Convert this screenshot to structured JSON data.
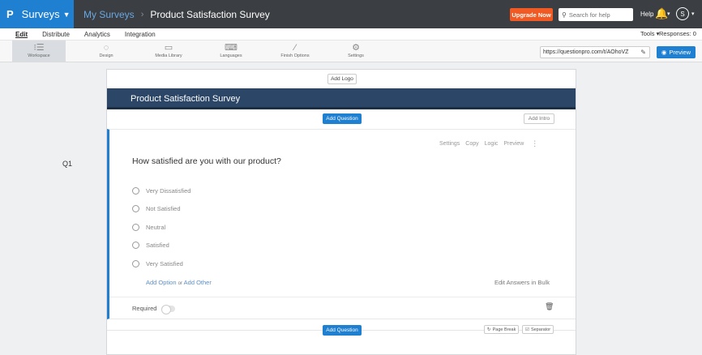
{
  "topbar": {
    "brand_logo": "P",
    "brand_label": "Surveys",
    "breadcrumb_mine": "My Surveys",
    "breadcrumb_sep": "›",
    "survey_title": "Product Satisfaction Survey",
    "upgrade_label": "Upgrade Now",
    "search_placeholder": "Search for help",
    "help_label": "Help",
    "avatar_initial": "S"
  },
  "tabs": {
    "items": [
      "Edit",
      "Distribute",
      "Analytics",
      "Integration"
    ],
    "tools_label": "Tools ▾",
    "responses_label": "Responses: 0"
  },
  "toolbar": {
    "items": [
      "Workspace",
      "Design",
      "Media Library",
      "Languages",
      "Finish Options",
      "Settings"
    ],
    "url_value": "https://questionpro.com/t/AOhoVZ",
    "preview_label": "Preview"
  },
  "survey": {
    "add_logo": "Add Logo",
    "header_title": "Product Satisfaction Survey",
    "add_question": "Add Question",
    "add_intro": "Add Intro",
    "question_number": "Q1",
    "question_actions": [
      "Settings",
      "Copy",
      "Logic",
      "Preview"
    ],
    "question_text": "How satisfied are you with our product?",
    "options": [
      "Very Dissatisfied",
      "Not Satisfied",
      "Neutral",
      "Satisfied",
      "Very Satisfied"
    ],
    "add_option": "Add Option",
    "or_text": "or",
    "add_other": "Add Other",
    "edit_bulk": "Edit Answers in Bulk",
    "required_label": "Required",
    "page_break": "Page Break",
    "separator": "Separator"
  },
  "colors": {
    "brand_blue": "#1f7fd0",
    "upgrade_orange": "#f15a22",
    "header_navy": "#2b4666",
    "topbar_dark": "#3b3e42"
  }
}
